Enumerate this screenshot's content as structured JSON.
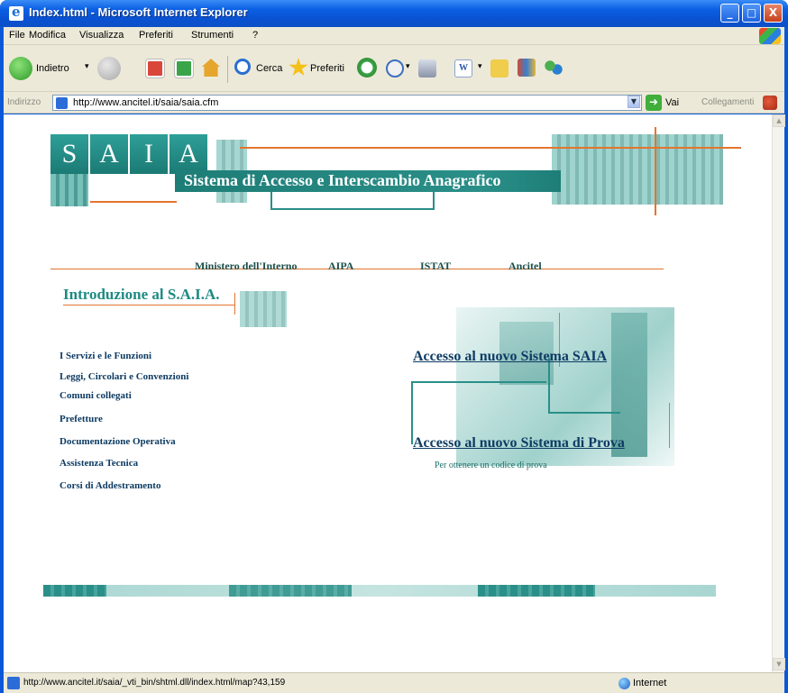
{
  "window": {
    "title": "Index.html - Microsoft Internet Explorer",
    "controls": {
      "minimize": "_",
      "maximize": "□",
      "close": "X"
    }
  },
  "menu": [
    "File",
    "Modifica",
    "Visualizza",
    "Preferiti",
    "Strumenti",
    "?"
  ],
  "toolbar": {
    "back_label": "Indietro",
    "search_label": "Cerca",
    "favorites_label": "Preferiti"
  },
  "address": {
    "label": "Indirizzo",
    "url": "http://www.ancitel.it/saia/saia.cfm",
    "go_label": "Vai",
    "links_label": "Collegamenti"
  },
  "page": {
    "logo_letters": [
      "S",
      "A",
      "I",
      "A"
    ],
    "banner_title": "Sistema di Accesso e Interscambio Anagrafico",
    "nav": [
      "Ministero dell'Interno",
      "AIPA",
      "ISTAT",
      "Ancitel"
    ],
    "intro_title": "Introduzione al S.A.I.A.",
    "side_links": [
      "I Servizi e le Funzioni",
      "Leggi, Circolari e Convenzioni",
      "Comuni collegati",
      "Prefetture",
      "Documentazione Operativa",
      "Assistenza Tecnica",
      "Corsi di Addestramento"
    ],
    "access_link": "Accesso al nuovo Sistema SAIA",
    "test_link": "Accesso al nuovo Sistema di Prova",
    "test_code_link": "Per ottenere un codice di prova"
  },
  "status": {
    "text": "http://www.ancitel.it/saia/_vti_bin/shtml.dll/index.html/map?43,159",
    "zone": "Internet"
  },
  "colors": {
    "teal": "#2a8f88",
    "orange": "#e2752e",
    "link_navy": "#0d3b63",
    "xp_blue": "#0b5fe3"
  }
}
